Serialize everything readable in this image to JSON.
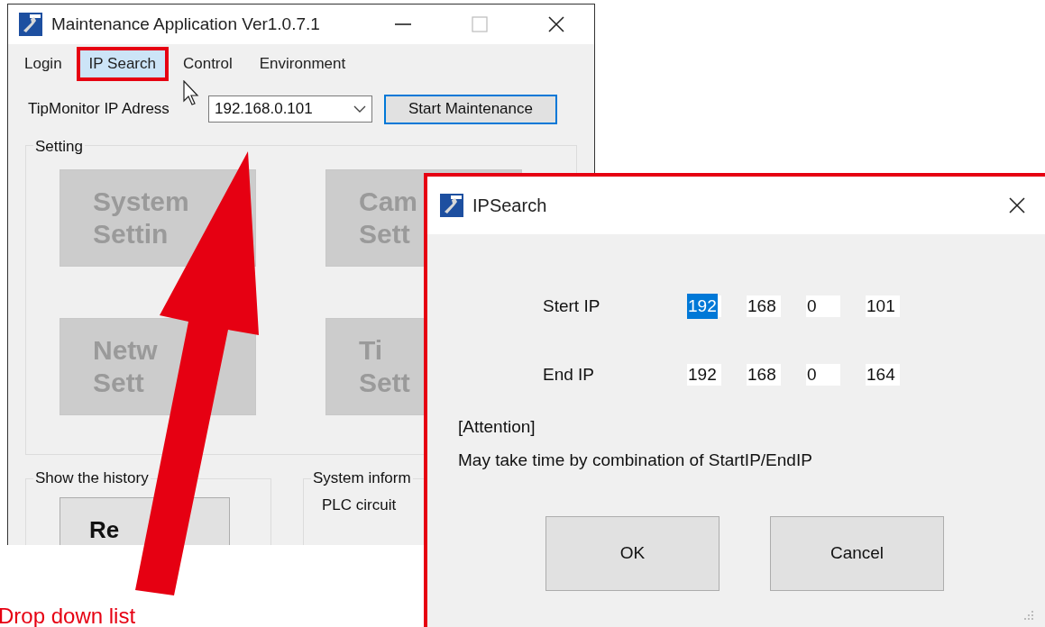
{
  "main_window": {
    "title": "Maintenance Application Ver1.0.7.1",
    "menu": [
      {
        "label": "Login",
        "selected": false,
        "annotated": false
      },
      {
        "label": "IP Search",
        "selected": true,
        "annotated": true
      },
      {
        "label": "Control",
        "selected": false,
        "annotated": false
      },
      {
        "label": "Environment",
        "selected": false,
        "annotated": false
      }
    ],
    "ip_label": "TipMonitor IP Adress",
    "ip_combo": {
      "value": "192.168.0.101"
    },
    "start_button": {
      "label": "Start Maintenance",
      "focused": true
    },
    "setting_group": {
      "title": "Setting",
      "buttons": [
        {
          "lines": [
            "System",
            "Settin"
          ],
          "disabled": true
        },
        {
          "lines": [
            "Cam",
            "Sett"
          ],
          "disabled": true
        },
        {
          "lines": [
            "Netw",
            "Sett"
          ],
          "disabled": true
        },
        {
          "lines": [
            "Ti",
            "Sett"
          ],
          "disabled": true
        }
      ]
    },
    "history_group": {
      "title": "Show the history",
      "button": "Re"
    },
    "info_group": {
      "title": "System inform",
      "line": "PLC circuit"
    }
  },
  "dialog": {
    "title": "IPSearch",
    "annotated": true,
    "rows": [
      {
        "label": "Stert IP",
        "octets": [
          {
            "value": "192",
            "selected": true
          },
          {
            "value": "168",
            "selected": false
          },
          {
            "value": "0",
            "selected": false
          },
          {
            "value": "101",
            "selected": false
          }
        ]
      },
      {
        "label": "End IP",
        "octets": [
          {
            "value": "192",
            "selected": false
          },
          {
            "value": "168",
            "selected": false
          },
          {
            "value": "0",
            "selected": false
          },
          {
            "value": "164",
            "selected": false
          }
        ]
      }
    ],
    "attention": "[Attention]",
    "note": "May take time by combination of StartIP/EndIP",
    "buttons": [
      "OK",
      "Cancel"
    ]
  },
  "caption": "Drop down list"
}
